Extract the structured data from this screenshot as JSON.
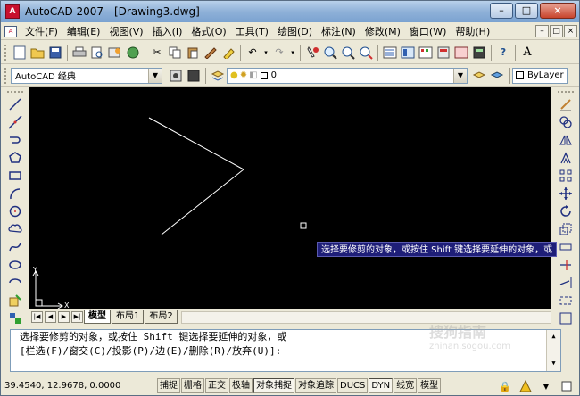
{
  "window": {
    "title": "AutoCAD 2007 - [Drawing3.dwg]",
    "app_icon": "autocad-a-icon",
    "controls": [
      "–",
      "□",
      "×"
    ]
  },
  "menubar": {
    "items": [
      "文件(F)",
      "编辑(E)",
      "视图(V)",
      "插入(I)",
      "格式(O)",
      "工具(T)",
      "绘图(D)",
      "标注(N)",
      "修改(M)",
      "窗口(W)",
      "帮助(H)"
    ],
    "mdi_controls": [
      "–",
      "□",
      "×"
    ]
  },
  "workspace": {
    "name": "AutoCAD 经典"
  },
  "layer": {
    "current": "0",
    "linetype": "ByLayer"
  },
  "layout_tabs": {
    "tabs": [
      "模型",
      "布局1",
      "布局2"
    ],
    "active": "模型"
  },
  "tooltip": {
    "text": "选择要修剪的对象，或按住 Shift 键选择要延伸的对象，或"
  },
  "command": {
    "line1": "选择要修剪的对象，或按住 Shift 键选择要延伸的对象，或",
    "line2": "[栏选(F)/窗交(C)/投影(P)/边(E)/删除(R)/放弃(U)]:"
  },
  "status": {
    "coords": "39.4540, 12.9678, 0.0000",
    "toggles": [
      {
        "label": "捕捉",
        "on": false
      },
      {
        "label": "栅格",
        "on": false
      },
      {
        "label": "正交",
        "on": false
      },
      {
        "label": "极轴",
        "on": false
      },
      {
        "label": "对象捕捉",
        "on": true
      },
      {
        "label": "对象追踪",
        "on": false
      },
      {
        "label": "DUCS",
        "on": false
      },
      {
        "label": "DYN",
        "on": true
      },
      {
        "label": "线宽",
        "on": false
      },
      {
        "label": "模型",
        "on": false
      }
    ]
  },
  "ucs": {
    "x_label": "X",
    "y_label": "Y"
  },
  "watermark": {
    "main": "搜狗指南",
    "url": "zhinan.sogou.com"
  },
  "colors": {
    "canvas": "#000000",
    "tooltip_bg": "#1e1e78",
    "title_gradient": "#8fb1d8",
    "drawing_line": "#ffffff"
  }
}
